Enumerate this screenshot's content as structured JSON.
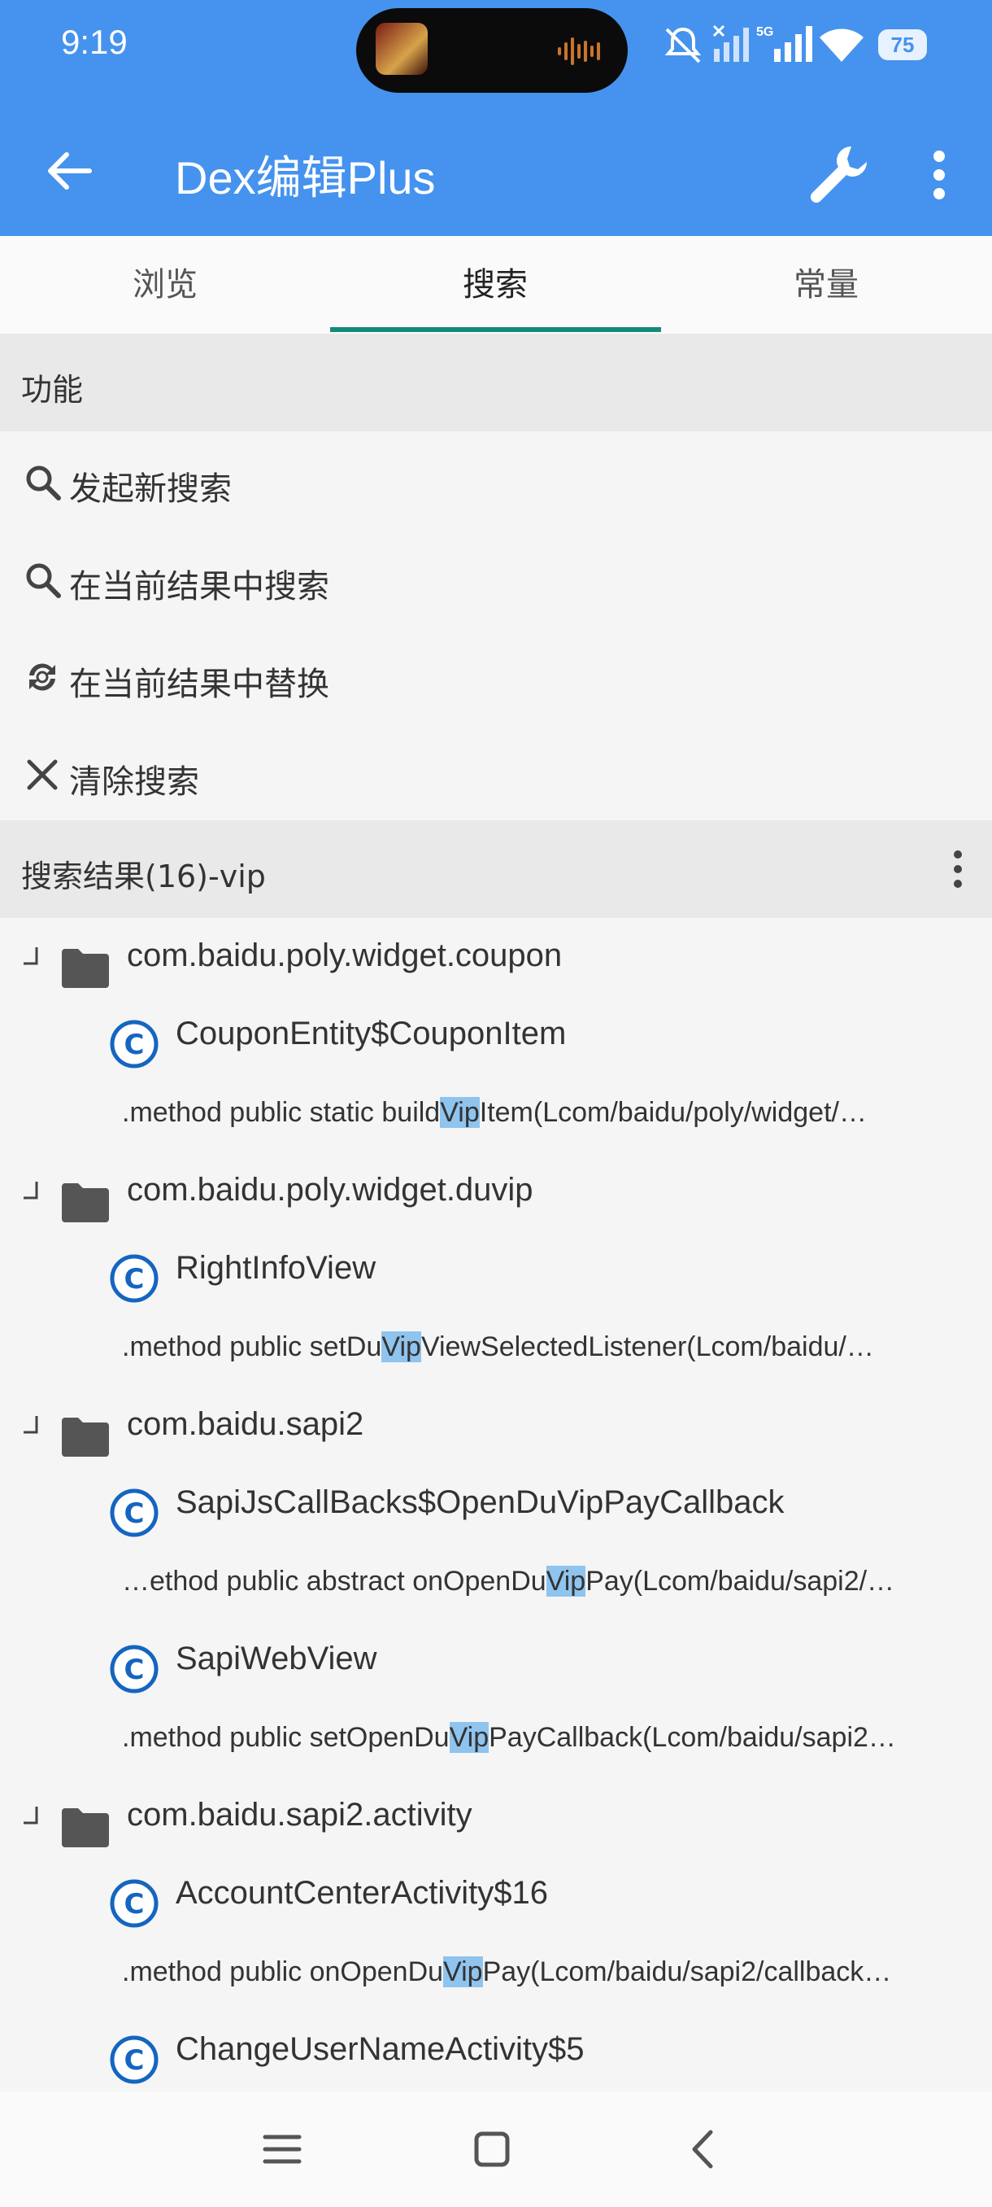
{
  "status_bar": {
    "time": "9:19",
    "network": "5G",
    "battery": "75"
  },
  "toolbar": {
    "title": "Dex编辑Plus"
  },
  "tabs": [
    {
      "label": "浏览"
    },
    {
      "label": "搜索"
    },
    {
      "label": "常量"
    }
  ],
  "functions": {
    "header": "功能",
    "items": [
      {
        "label": "发起新搜索",
        "icon": "search-icon"
      },
      {
        "label": "在当前结果中搜索",
        "icon": "search-icon"
      },
      {
        "label": "在当前结果中替换",
        "icon": "replace-icon"
      },
      {
        "label": "清除搜索",
        "icon": "close-icon"
      }
    ]
  },
  "results": {
    "header": "搜索结果(16)-vip",
    "tree": [
      {
        "kind": "package",
        "text": "com.baidu.poly.widget.coupon"
      },
      {
        "kind": "class",
        "text": "CouponEntity$CouponItem"
      },
      {
        "kind": "method",
        "before": ".method public static build",
        "match": "Vip",
        "after": "Item(Lcom/baidu/poly/widget/…"
      },
      {
        "kind": "package",
        "text": "com.baidu.poly.widget.duvip"
      },
      {
        "kind": "class",
        "text": "RightInfoView"
      },
      {
        "kind": "method",
        "before": ".method public setDu",
        "match": "Vip",
        "after": "ViewSelectedListener(Lcom/baidu/…"
      },
      {
        "kind": "package",
        "text": "com.baidu.sapi2"
      },
      {
        "kind": "class",
        "text": "SapiJsCallBacks$OpenDuVipPayCallback"
      },
      {
        "kind": "method",
        "before": "…ethod public abstract onOpenDu",
        "match": "Vip",
        "after": "Pay(Lcom/baidu/sapi2/…"
      },
      {
        "kind": "class",
        "text": "SapiWebView"
      },
      {
        "kind": "method",
        "before": ".method public setOpenDu",
        "match": "Vip",
        "after": "PayCallback(Lcom/baidu/sapi2…"
      },
      {
        "kind": "package",
        "text": "com.baidu.sapi2.activity"
      },
      {
        "kind": "class",
        "text": "AccountCenterActivity$16"
      },
      {
        "kind": "method",
        "before": ".method public onOpenDu",
        "match": "Vip",
        "after": "Pay(Lcom/baidu/sapi2/callback…"
      },
      {
        "kind": "class",
        "text": "ChangeUserNameActivity$5"
      }
    ]
  },
  "colors": {
    "app_bar": "#4593ee",
    "tab_indicator": "#158a7c",
    "class_icon": "#1565c0",
    "highlight": "#8fc4ef"
  }
}
